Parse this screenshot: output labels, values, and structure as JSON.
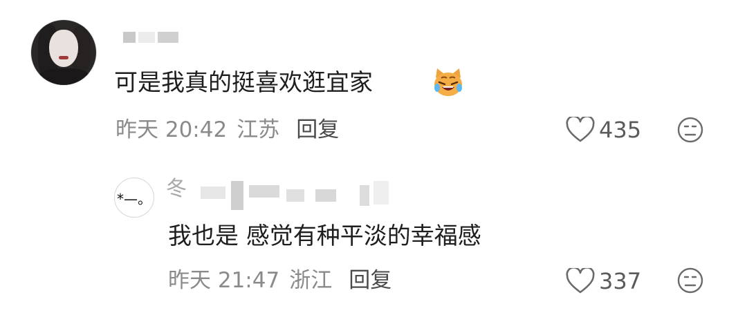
{
  "top_comment": {
    "text": "可是我真的挺喜欢逛宜家",
    "emoji": "crying-laughing-cat-emoji",
    "time": "昨天 20:42",
    "location": "江苏",
    "reply_label": "回复",
    "likes": "435"
  },
  "reply": {
    "avatar_text": "*—。",
    "username_visible": "冬",
    "text": "我也是 感觉有种平淡的幸福感",
    "time": "昨天 21:47",
    "location": "浙江",
    "reply_label": "回复",
    "likes": "337"
  },
  "icons": {
    "like": "heart-outline-icon",
    "dislike": "frown-face-icon"
  },
  "colors": {
    "primary_text": "#1e1e1e",
    "meta_text": "#8a8a8a",
    "emoji_orange": "#f2a23a"
  }
}
